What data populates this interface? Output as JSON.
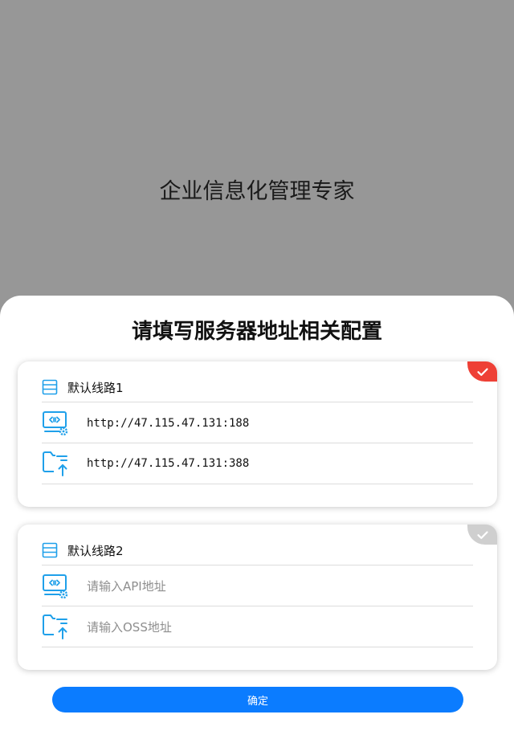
{
  "background": {
    "title": "企业信息化管理专家"
  },
  "sheet": {
    "title": "请填写服务器地址相关配置",
    "confirm_label": "确定"
  },
  "colors": {
    "accent": "#0b7cff",
    "icon_blue": "#1fa0ea",
    "selected_badge": "#ee4036",
    "unselected_badge": "#cfcfcf"
  },
  "lines": [
    {
      "label": "默认线路1",
      "selected": true,
      "api_value": "http://47.115.47.131:188",
      "api_placeholder": "",
      "oss_value": "http://47.115.47.131:388",
      "oss_placeholder": ""
    },
    {
      "label": "默认线路2",
      "selected": false,
      "api_value": "",
      "api_placeholder": "请输入API地址",
      "oss_value": "",
      "oss_placeholder": "请输入OSS地址"
    }
  ],
  "icons": {
    "line": "server-list-icon",
    "api": "api-settings-icon",
    "oss": "folder-upload-icon",
    "badge": "check-icon"
  }
}
